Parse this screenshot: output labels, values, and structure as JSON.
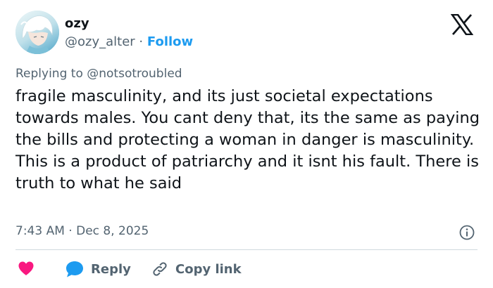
{
  "colors": {
    "accent": "#1d9bf0",
    "text": "#0f1419",
    "muted": "#536471",
    "like": "#f91880",
    "divider": "#cfd9de"
  },
  "author": {
    "display_name": "ozy",
    "handle": "@ozy_alter",
    "separator": "·",
    "follow_label": "Follow",
    "avatar_icon": "anime-avatar"
  },
  "header": {
    "logo_icon": "x-logo-icon"
  },
  "tweet": {
    "reply_prefix": "Replying to ",
    "reply_handle": "@notsotroubled",
    "text": "fragile masculinity, and its just societal expectations towards males. You cant deny that, its the same as paying the bills and protecting a woman in danger is masculinity. This is a product of patriarchy and it isnt his fault. There is truth to what he said",
    "time": "7:43 AM",
    "separator": "·",
    "date": "Dec 8, 2025",
    "info_icon": "info-icon"
  },
  "actions": {
    "like_icon": "heart-icon",
    "reply_icon": "reply-bubble-icon",
    "reply_label": "Reply",
    "copy_icon": "link-icon",
    "copy_label": "Copy link"
  }
}
